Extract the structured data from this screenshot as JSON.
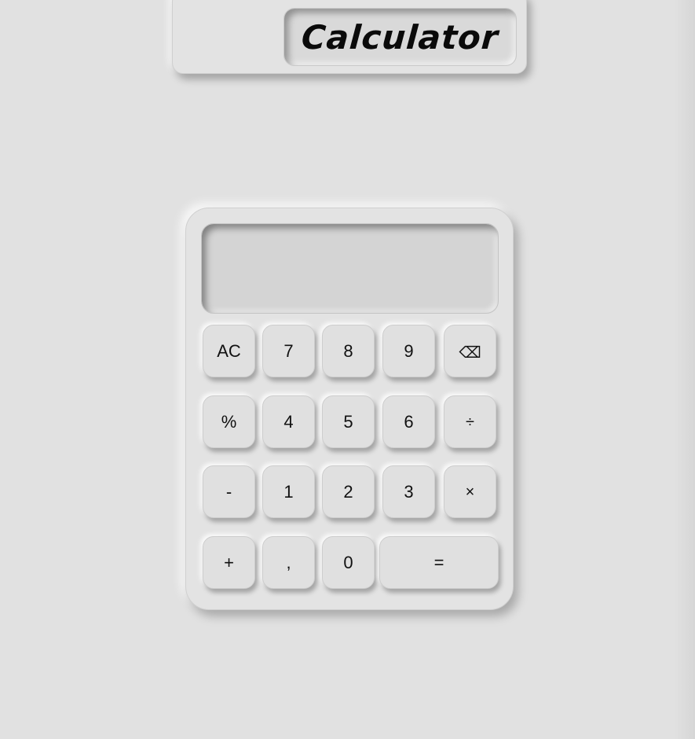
{
  "header": {
    "title": "Calculator"
  },
  "calculator": {
    "display_value": "",
    "keys": {
      "clear": "AC",
      "seven": "7",
      "eight": "8",
      "nine": "9",
      "backspace": "⌫",
      "percent": "%",
      "four": "4",
      "five": "5",
      "six": "6",
      "divide": "÷",
      "minus": "-",
      "one": "1",
      "two": "2",
      "three": "3",
      "multiply": "×",
      "plus": "+",
      "comma": ",",
      "zero": "0",
      "equals": "="
    }
  },
  "colors": {
    "background": "#e1e1e1",
    "surface": "#e3e3e3",
    "display": "#d4d4d4",
    "text": "#111111"
  }
}
